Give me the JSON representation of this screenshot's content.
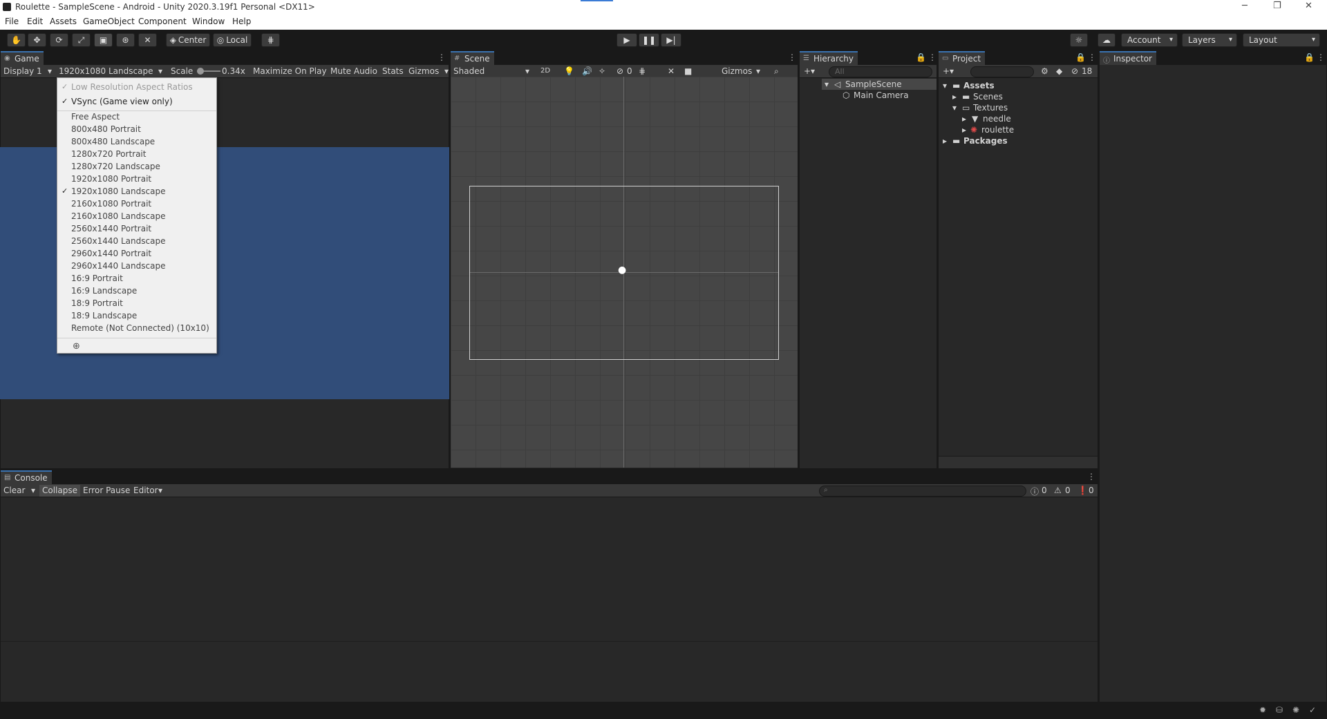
{
  "window": {
    "title": "Roulette - SampleScene - Android - Unity 2020.3.19f1 Personal <DX11>",
    "minimize": "─",
    "restore": "❐",
    "close": "✕"
  },
  "menu": [
    "File",
    "Edit",
    "Assets",
    "GameObject",
    "Component",
    "Window",
    "Help"
  ],
  "toolbar": {
    "pivot_label": "Center",
    "space_label": "Local",
    "account_label": "Account",
    "layers_label": "Layers",
    "layout_label": "Layout"
  },
  "game": {
    "tab": "Game",
    "display": "Display 1",
    "resolution": "1920x1080 Landscape",
    "scale_label": "Scale",
    "scale_value": "0.34x",
    "maximize": "Maximize On Play",
    "mute": "Mute Audio",
    "stats": "Stats",
    "gizmos": "Gizmos"
  },
  "aspect_menu": {
    "low_res": "Low Resolution Aspect Ratios",
    "vsync": "VSync (Game view only)",
    "items": [
      "Free Aspect",
      "800x480 Portrait",
      "800x480 Landscape",
      "1280x720 Portrait",
      "1280x720 Landscape",
      "1920x1080 Portrait",
      "1920x1080 Landscape",
      "2160x1080 Portrait",
      "2160x1080 Landscape",
      "2560x1440 Portrait",
      "2560x1440 Landscape",
      "2960x1440 Portrait",
      "2960x1440 Landscape",
      "16:9 Portrait",
      "16:9 Landscape",
      "18:9 Portrait",
      "18:9 Landscape",
      "Remote (Not Connected) (10x10)"
    ],
    "selected": "1920x1080 Landscape"
  },
  "scene": {
    "tab": "Scene",
    "shading": "Shaded",
    "mode_2d": "2D",
    "hidden_count": "0",
    "gizmos": "Gizmos"
  },
  "hierarchy": {
    "tab": "Hierarchy",
    "search_placeholder": "All",
    "scene_name": "SampleScene",
    "items": [
      "Main Camera"
    ]
  },
  "project": {
    "tab": "Project",
    "hidden_count": "18",
    "assets": "Assets",
    "scenes": "Scenes",
    "textures": "Textures",
    "needle": "needle",
    "roulette": "roulette",
    "packages": "Packages"
  },
  "inspector": {
    "tab": "Inspector"
  },
  "console": {
    "tab": "Console",
    "clear": "Clear",
    "collapse": "Collapse",
    "error_pause": "Error Pause",
    "editor": "Editor",
    "log_count": "0",
    "warn_count": "0",
    "error_count": "0"
  },
  "colors": {
    "game_background": "#314d79",
    "accent": "#3a72b0"
  }
}
